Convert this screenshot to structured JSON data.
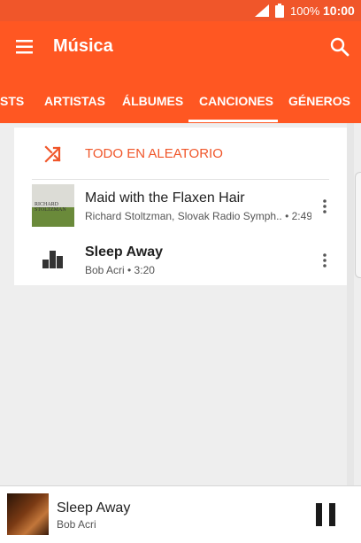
{
  "status_bar": {
    "battery_percent": "100%",
    "time": "10:00"
  },
  "app_bar": {
    "title": "Música"
  },
  "tabs": [
    {
      "label": "STS"
    },
    {
      "label": "ARTISTAS"
    },
    {
      "label": "ÁLBUMES"
    },
    {
      "label": "CANCIONES",
      "selected": true
    },
    {
      "label": "GÉNEROS"
    }
  ],
  "shuffle_all": {
    "label": "TODO EN ALEATORIO"
  },
  "songs": [
    {
      "title": "Maid with the Flaxen Hair",
      "subtitle": "Richard Stoltzman, Slovak Radio Symph.. • 2:49",
      "art_text": "RICHARD STOLTZMAN"
    },
    {
      "title": "Sleep Away",
      "subtitle": "Bob Acri • 3:20"
    }
  ],
  "now_playing": {
    "title": "Sleep Away",
    "artist": "Bob Acri"
  },
  "colors": {
    "accent": "#ff5722",
    "status_bar": "#f0562a",
    "shuffle_text": "#f0562a"
  },
  "icons": {
    "menu": "menu-icon",
    "search": "search-icon",
    "shuffle": "shuffle-icon",
    "more": "more-vert-icon",
    "pause": "pause-icon",
    "signal": "signal-icon",
    "battery": "battery-icon"
  }
}
